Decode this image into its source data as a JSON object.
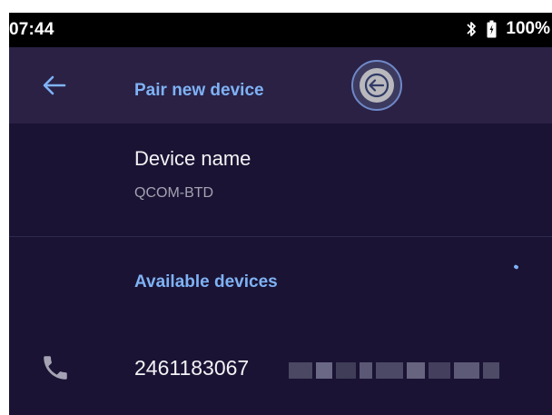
{
  "status_bar": {
    "time": "07:44",
    "battery": "100%",
    "icons": [
      "bluetooth-icon",
      "battery-icon"
    ]
  },
  "app_bar": {
    "title": "Pair new device",
    "back_icon": "arrow-left-icon"
  },
  "touch_indicator": {
    "icon": "arrow-left-icon"
  },
  "device_name": {
    "label": "Device name",
    "value": "QCOM-BTD"
  },
  "available_devices": {
    "header": "Available devices",
    "scanning": true,
    "items": [
      {
        "name": "2461183067",
        "icon": "phone-icon",
        "name_suffix_redacted": true
      }
    ]
  },
  "colors": {
    "background": "#1a1333",
    "app_bar": "#2a2145",
    "accent": "#7fb2f5",
    "primary_text": "#f2f2f5",
    "secondary_text": "#a4a2b3"
  }
}
